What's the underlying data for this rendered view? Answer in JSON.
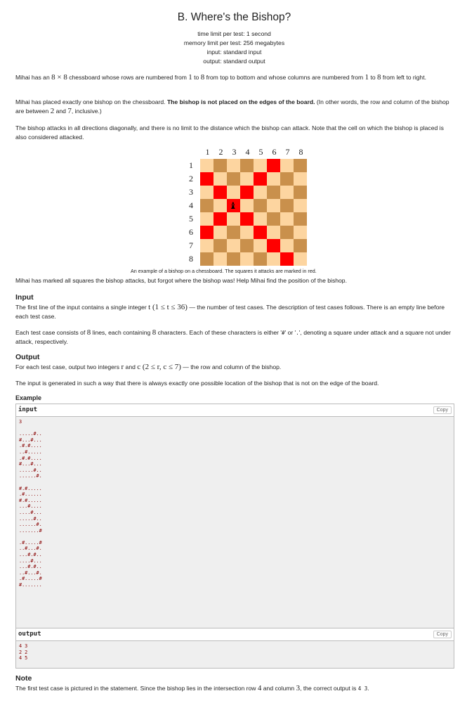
{
  "problem": {
    "title": "B. Where's the Bishop?",
    "time_limit": "time limit per test: 1 second",
    "memory_limit": "memory limit per test: 256 megabytes",
    "input_file": "input: standard input",
    "output_file": "output: standard output"
  },
  "statement": {
    "p1_a": "Mihai has an ",
    "p1_m1": "8 × 8",
    "p1_b": " chessboard whose rows are numbered from ",
    "p1_m2": "1",
    "p1_c": " to ",
    "p1_m3": "8",
    "p1_d": " from top to bottom and whose columns are numbered from ",
    "p1_m4": "1",
    "p1_e": " to ",
    "p1_m5": "8",
    "p1_f": " from left to right.",
    "p2_a": "Mihai has placed exactly one bishop on the chessboard. ",
    "p2_bold": "The bishop is not placed on the edges of the board.",
    "p2_b": " (In other words, the row and column of the bishop are between ",
    "p2_m1": "2",
    "p2_c": " and ",
    "p2_m2": "7",
    "p2_d": ", inclusive.)",
    "p3": "The bishop attacks in all directions diagonally, and there is no limit to the distance which the bishop can attack. Note that the cell on which the bishop is placed is also considered attacked.",
    "caption": "An example of a bishop on a chessboard. The squares it attacks are marked in red.",
    "p4": "Mihai has marked all squares the bishop attacks, but forgot where the bishop was! Help Mihai find the position of the bishop."
  },
  "board": {
    "col_labels": [
      "1",
      "2",
      "3",
      "4",
      "5",
      "6",
      "7",
      "8"
    ],
    "row_labels": [
      "1",
      "2",
      "3",
      "4",
      "5",
      "6",
      "7",
      "8"
    ],
    "colors": {
      "light": "#fdd5a0",
      "dark": "#c9904c",
      "attacked": "#ff0000"
    },
    "bishop_row": 4,
    "bishop_col": 3,
    "bishop_glyph": "♝"
  },
  "input_section": {
    "title": "Input",
    "p1_a": "The first line of the input contains a single integer ",
    "p1_m": "t (1 ≤ t ≤ 36)",
    "p1_b": " — the number of test cases. The description of test cases follows. There is an empty line before each test case.",
    "p2_a": "Each test case consists of ",
    "p2_m": "8",
    "p2_b": " lines, each containing ",
    "p2_m2": "8",
    "p2_c": " characters. Each of these characters is either '",
    "p2_code1": "#",
    "p2_d": "' or '",
    "p2_code2": ".",
    "p2_e": "', denoting a square under attack and a square not under attack, respectively."
  },
  "output_section": {
    "title": "Output",
    "p1_a": "For each test case, output two integers ",
    "p1_m1": "r",
    "p1_b": " and ",
    "p1_m2": "c (2 ≤ r, c ≤ 7)",
    "p1_c": " — the row and column of the bishop.",
    "p2": "The input is generated in such a way that there is always exactly one possible location of the bishop that is not on the edge of the board."
  },
  "example": {
    "title": "Example",
    "input_label": "input",
    "output_label": "output",
    "copy_label": "Copy",
    "input_text": "3\n\n.....#..\n#...#...\n.#.#....\n..#.....\n.#.#....\n#...#...\n.....#..\n......#.\n\n#.#.....\n.#......\n#.#.....\n...#....\n....#...\n.....#..\n......#.\n.......#\n\n.#.....#\n..#...#.\n...#.#..\n....#...\n...#.#..\n..#...#.\n.#.....#\n#.......",
    "output_text": "4 3\n2 2\n4 5"
  },
  "note": {
    "title": "Note",
    "text_a": "The first test case is pictured in the statement. Since the bishop lies in the intersection row ",
    "m1": "4",
    "text_b": " and column ",
    "m2": "3",
    "text_c": ", the correct output is ",
    "code": "4 3",
    "text_d": "."
  }
}
